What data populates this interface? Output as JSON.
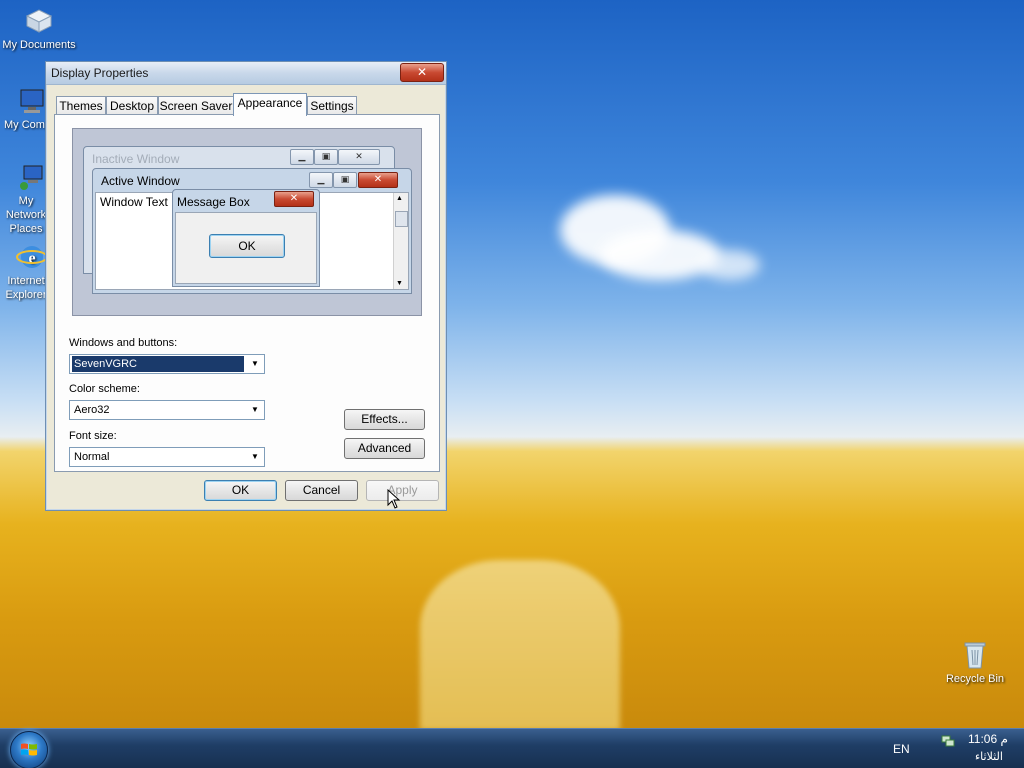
{
  "desktop": {
    "icons": [
      {
        "label": "My Documents",
        "icon": "folder-documents-icon"
      },
      {
        "label": "My Computer",
        "icon": "computer-icon"
      },
      {
        "label": "My Network Places",
        "icon": "network-icon"
      },
      {
        "label": "Internet Explorer",
        "icon": "internet-explorer-icon"
      },
      {
        "label": "Recycle Bin",
        "icon": "recycle-bin-icon"
      }
    ]
  },
  "dialog": {
    "title": "Display Properties",
    "close_glyph": "✕",
    "tabs": [
      {
        "label": "Themes"
      },
      {
        "label": "Desktop"
      },
      {
        "label": "Screen Saver"
      },
      {
        "label": "Appearance",
        "active": true
      },
      {
        "label": "Settings"
      }
    ],
    "preview": {
      "inactive_title": "Inactive Window",
      "active_title": "Active Window",
      "window_text": "Window Text",
      "message_title": "Message Box",
      "message_ok": "OK"
    },
    "windows_and_buttons": {
      "label": "Windows and buttons:",
      "value": "SevenVGRC"
    },
    "color_scheme": {
      "label": "Color scheme:",
      "value": "Aero32"
    },
    "font_size": {
      "label": "Font size:",
      "value": "Normal"
    },
    "effects_label": "Effects...",
    "advanced_label": "Advanced",
    "ok_label": "OK",
    "cancel_label": "Cancel",
    "apply_label": "Apply"
  },
  "taskbar": {
    "language": "EN",
    "clock_time": "11:06 م",
    "clock_day": "الثلاثاء"
  },
  "colors": {
    "sky_top": "#1d63c4",
    "field": "#e7b21e",
    "dialog_bg": "#ece9d8",
    "close_red": "#c94a32",
    "selection": "#1a3a6b"
  }
}
